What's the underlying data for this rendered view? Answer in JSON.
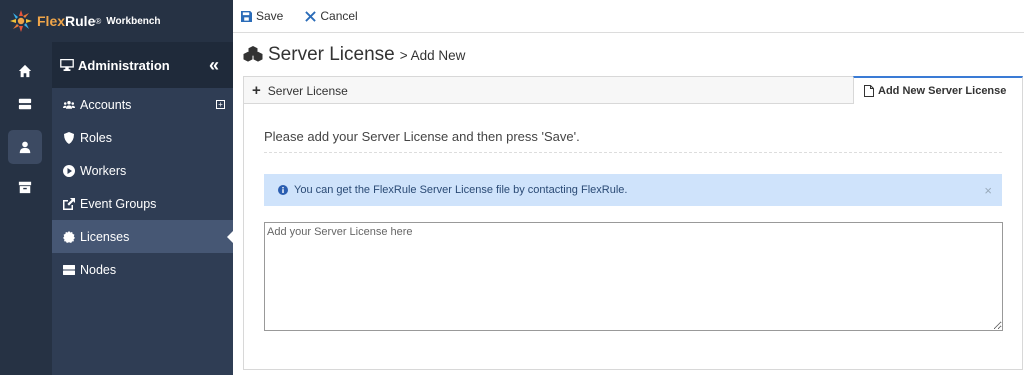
{
  "brand": {
    "name_part1": "Flex",
    "name_part2": "Rule",
    "registered": "®",
    "product": "Workbench"
  },
  "rail": {
    "items": [
      {
        "icon": "home-icon"
      },
      {
        "icon": "server-icon"
      },
      {
        "icon": "user-icon",
        "active": true
      },
      {
        "icon": "archive-icon"
      }
    ]
  },
  "sidebar": {
    "title": "Administration",
    "collapse_glyph": "«",
    "items": [
      {
        "label": "Accounts",
        "icon": "users-icon",
        "expandable": true
      },
      {
        "label": "Roles",
        "icon": "shield-icon"
      },
      {
        "label": "Workers",
        "icon": "play-circle-icon"
      },
      {
        "label": "Event Groups",
        "icon": "external-link-icon"
      },
      {
        "label": "Licenses",
        "icon": "certificate-icon",
        "active": true
      },
      {
        "label": "Nodes",
        "icon": "server-icon"
      }
    ]
  },
  "toolbar": {
    "save_label": "Save",
    "cancel_label": "Cancel"
  },
  "page": {
    "title": "Server License",
    "subtitle": "> Add New"
  },
  "tabs": {
    "server_license": "Server License",
    "add_new": "Add New Server License"
  },
  "form": {
    "instruction": "Please add your Server License and then press 'Save'.",
    "alert": "You can get the FlexRule Server License file by contacting FlexRule.",
    "alert_close": "×",
    "license_placeholder": "Add your Server License here",
    "license_value": ""
  },
  "colors": {
    "rail_bg": "#263244",
    "sidebar_bg": "#2f3d54",
    "accent": "#3a7bd5",
    "alert_bg": "#cfe3fb"
  }
}
